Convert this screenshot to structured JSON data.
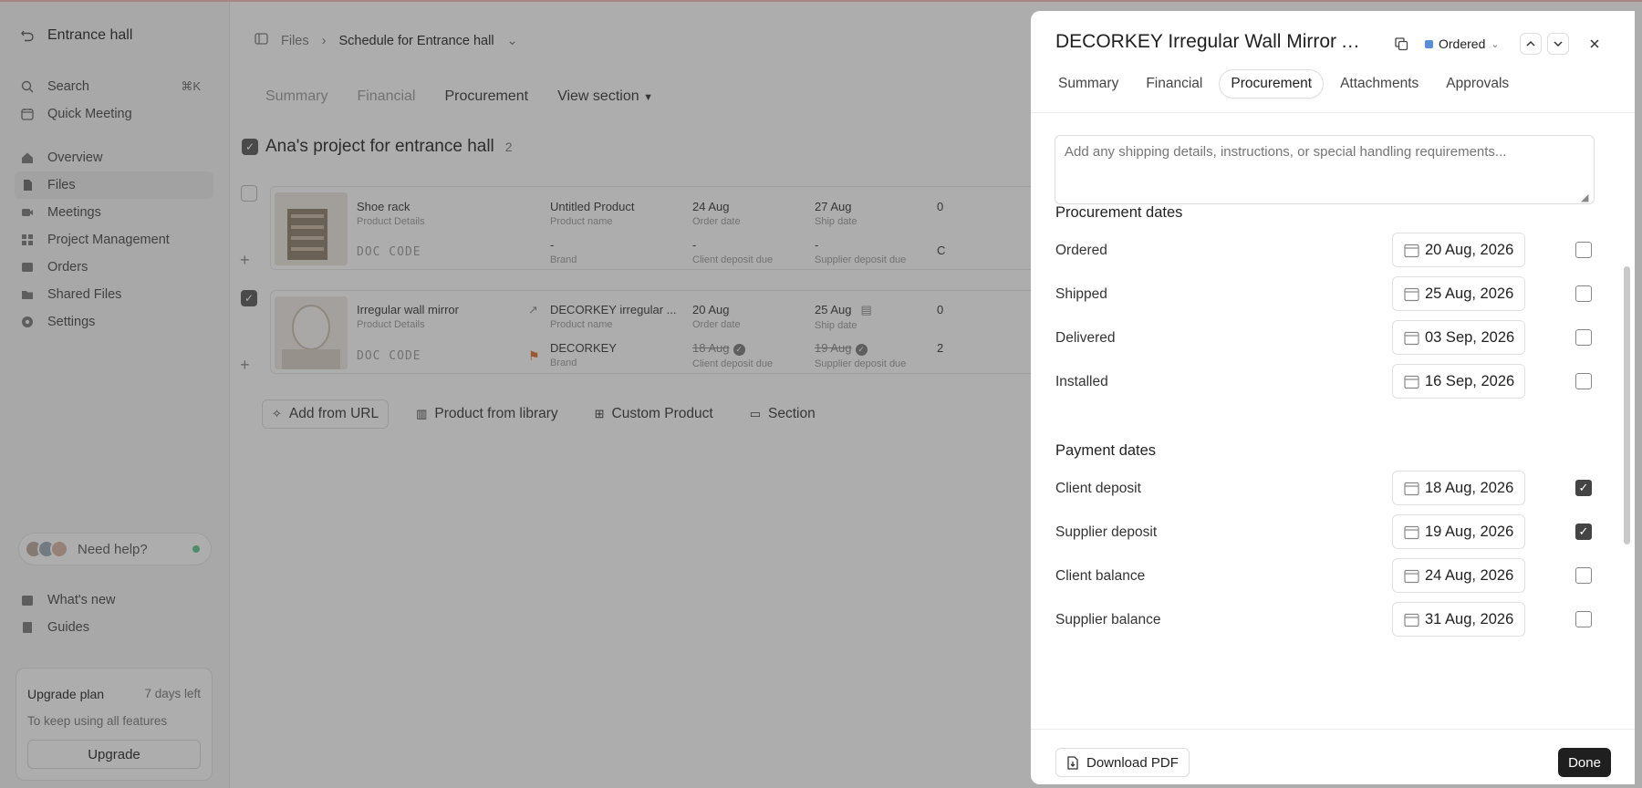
{
  "sidebar": {
    "workspace_title": "Entrance hall",
    "search_label": "Search",
    "search_shortcut": "⌘K",
    "quick_meeting": "Quick Meeting",
    "nav": [
      "Overview",
      "Files",
      "Meetings",
      "Project Management",
      "Orders",
      "Shared Files",
      "Settings"
    ],
    "active_nav": "Files",
    "help_label": "Need help?",
    "whats_new": "What's new",
    "guides": "Guides",
    "upgrade": {
      "title": "Upgrade plan",
      "days_left": "7 days left",
      "subtitle": "To keep using all features",
      "button": "Upgrade"
    }
  },
  "main": {
    "breadcrumb": {
      "files": "Files",
      "schedule": "Schedule for Entrance hall"
    },
    "tabs": [
      "Summary",
      "Financial",
      "Procurement",
      "View section"
    ],
    "active_tab": "Procurement",
    "project_title": "Ana's project for entrance hall",
    "project_count": "2",
    "rows": [
      {
        "name": "Shoe rack",
        "name_sub": "Product Details",
        "doc_code": "DOC CODE",
        "product_name": "Untitled Product",
        "product_name_sub": "Product name",
        "brand": "-",
        "brand_sub": "Brand",
        "order_date": "24 Aug",
        "order_date_sub": "Order date",
        "ship_date": "27 Aug",
        "ship_date_sub": "Ship date",
        "client_deposit": "-",
        "client_deposit_sub": "Client deposit due",
        "supplier_deposit": "-",
        "supplier_deposit_sub": "Supplier deposit due",
        "extra_top": "0",
        "extra_bottom": "C"
      },
      {
        "name": "Irregular wall mirror",
        "name_sub": "Product Details",
        "doc_code": "DOC CODE",
        "product_name": "DECORKEY irregular ...",
        "product_name_sub": "Product name",
        "brand": "DECORKEY",
        "brand_sub": "Brand",
        "order_date": "20 Aug",
        "order_date_sub": "Order date",
        "ship_date": "25 Aug",
        "ship_date_sub": "Ship date",
        "client_deposit": "18 Aug",
        "client_deposit_sub": "Client deposit due",
        "supplier_deposit": "19 Aug",
        "supplier_deposit_sub": "Supplier deposit due",
        "extra_top": "0",
        "extra_bottom": "2"
      }
    ],
    "actions": [
      "Add from URL",
      "Product from library",
      "Custom Product",
      "Section"
    ]
  },
  "drawer": {
    "title": "DECORKEY Irregular Wall Mirror A...",
    "status": "Ordered",
    "status_color": "#5a8fd8",
    "tabs": [
      "Summary",
      "Financial",
      "Procurement",
      "Attachments",
      "Approvals"
    ],
    "active_tab": "Procurement",
    "notes_placeholder": "Add any shipping details, instructions, or special handling requirements...",
    "procurement_dates": {
      "heading": "Procurement dates",
      "rows": [
        {
          "label": "Ordered",
          "date": "20 Aug, 2026",
          "checked": false
        },
        {
          "label": "Shipped",
          "date": "25 Aug, 2026",
          "checked": false
        },
        {
          "label": "Delivered",
          "date": "03 Sep, 2026",
          "checked": false
        },
        {
          "label": "Installed",
          "date": "16 Sep, 2026",
          "checked": false
        }
      ]
    },
    "payment_dates": {
      "heading": "Payment dates",
      "rows": [
        {
          "label": "Client deposit",
          "date": "18 Aug, 2026",
          "checked": true
        },
        {
          "label": "Supplier deposit",
          "date": "19 Aug, 2026",
          "checked": true
        },
        {
          "label": "Client balance",
          "date": "24 Aug, 2026",
          "checked": false
        },
        {
          "label": "Supplier balance",
          "date": "31 Aug, 2026",
          "checked": false
        }
      ]
    },
    "footer": {
      "download_pdf": "Download PDF",
      "done": "Done"
    }
  },
  "icons": {
    "back": "undo-arrow-icon",
    "search": "search-icon",
    "calendar": "calendar-icon",
    "close": "close-icon",
    "copy": "copy-icon",
    "chevron_up": "chevron-up-icon",
    "chevron_down": "chevron-down-icon"
  }
}
